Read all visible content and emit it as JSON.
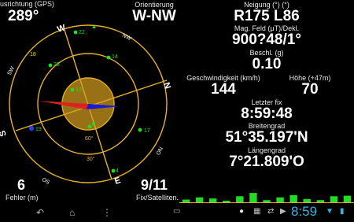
{
  "left": {
    "bearing_label": "usrichtung (GPS)",
    "bearing_value": "289°",
    "orientation_label": "Orientierung",
    "orientation_value": "W-NW",
    "error_value": "6",
    "error_label": "Fehler (m)",
    "fix_value": "9/11",
    "fix_label": "Fix/Satelliten."
  },
  "compass": {
    "cardinals": {
      "N": "N",
      "E": "E",
      "S": "S",
      "W": "W"
    },
    "intercardinals": {
      "NW": "NW",
      "NO": "NO",
      "SW": "SW",
      "SO": "SO"
    },
    "elevations": {
      "e30": "30°",
      "e60": "60°"
    },
    "satellites": [
      {
        "id": "22",
        "color": "#22dd22"
      },
      {
        "id": "14",
        "color": "#22dd22"
      },
      {
        "id": "25",
        "color": "#22dd22"
      },
      {
        "id": "13",
        "color": "#22dd22"
      },
      {
        "id": "18",
        "color": "#e0e020"
      },
      {
        "id": "19",
        "color": "#2244ff"
      },
      {
        "id": "17",
        "color": "#22dd22"
      },
      {
        "id": "4",
        "color": "#22dd22"
      }
    ],
    "colors": {
      "ring": "#e5b12a",
      "north": "#e02020",
      "south": "#1a1ad0",
      "course": "#e5b12a",
      "sun": "#d9a020"
    }
  },
  "right": {
    "tilt_label": "Neigung (°) (°)",
    "tilt_value": "R175 L86",
    "magfield_label": "Mag. Feld (μT)/Dekl.",
    "magfield_value": "900?48/1°",
    "accel_label": "Beschl. (g)",
    "accel_value": "0.10",
    "speed_label": "Geschwindigkeit (km/h)",
    "speed_value": "144",
    "altitude_label": "Höhe (+47m)",
    "altitude_value": "70",
    "lastfix_label": "Letzter fix",
    "lastfix_value": "8:59:48",
    "lat_label": "Breitengrad",
    "lat_value": "51°35.197'N",
    "lon_label": "Längengrad",
    "lon_value": "7°21.809'O"
  },
  "snr_bars": {
    "values": [
      0.25,
      0.45,
      0.35,
      0.15,
      0.55,
      0.85,
      0.2,
      0.45,
      0.65,
      0.3,
      0.2,
      0.55,
      0.6
    ],
    "color": "#22dd22",
    "baseline_color": "#e5b12a"
  },
  "navbar": {
    "back_icon": "back-icon",
    "home_icon": "home-icon",
    "recents_icon": "recents-icon",
    "menu_icon": "menu-icon",
    "clock": "8:59",
    "clock_color": "#33b5e5"
  }
}
